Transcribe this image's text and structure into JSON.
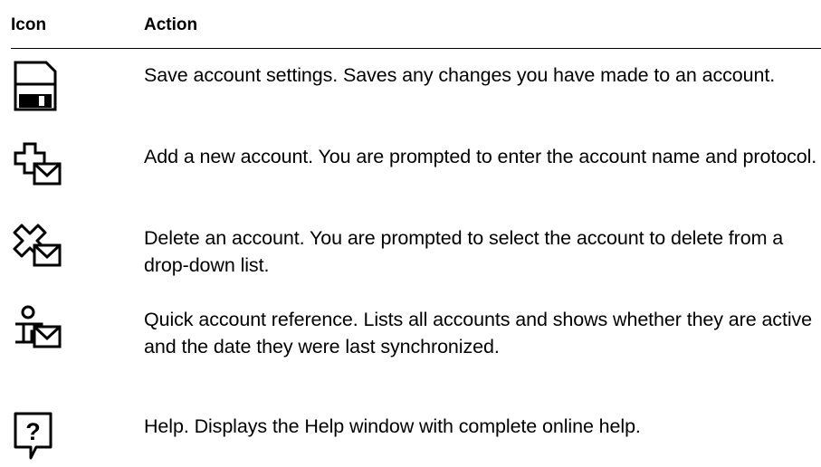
{
  "table": {
    "headers": {
      "icon": "Icon",
      "action": "Action"
    },
    "rows": [
      {
        "icon": "save-disk-icon",
        "action": "Save account settings. Saves any changes you have made to an account."
      },
      {
        "icon": "add-account-icon",
        "action": "Add a new account. You are prompted to enter the account name and protocol."
      },
      {
        "icon": "delete-account-icon",
        "action": "Delete an account. You are prompted to select the account to delete from a drop-down list."
      },
      {
        "icon": "account-reference-icon",
        "action": "Quick account reference. Lists all accounts and shows whether they are active and the date they were last synchronized."
      },
      {
        "icon": "help-icon",
        "action": "Help. Displays the Help window with complete online help."
      }
    ]
  }
}
